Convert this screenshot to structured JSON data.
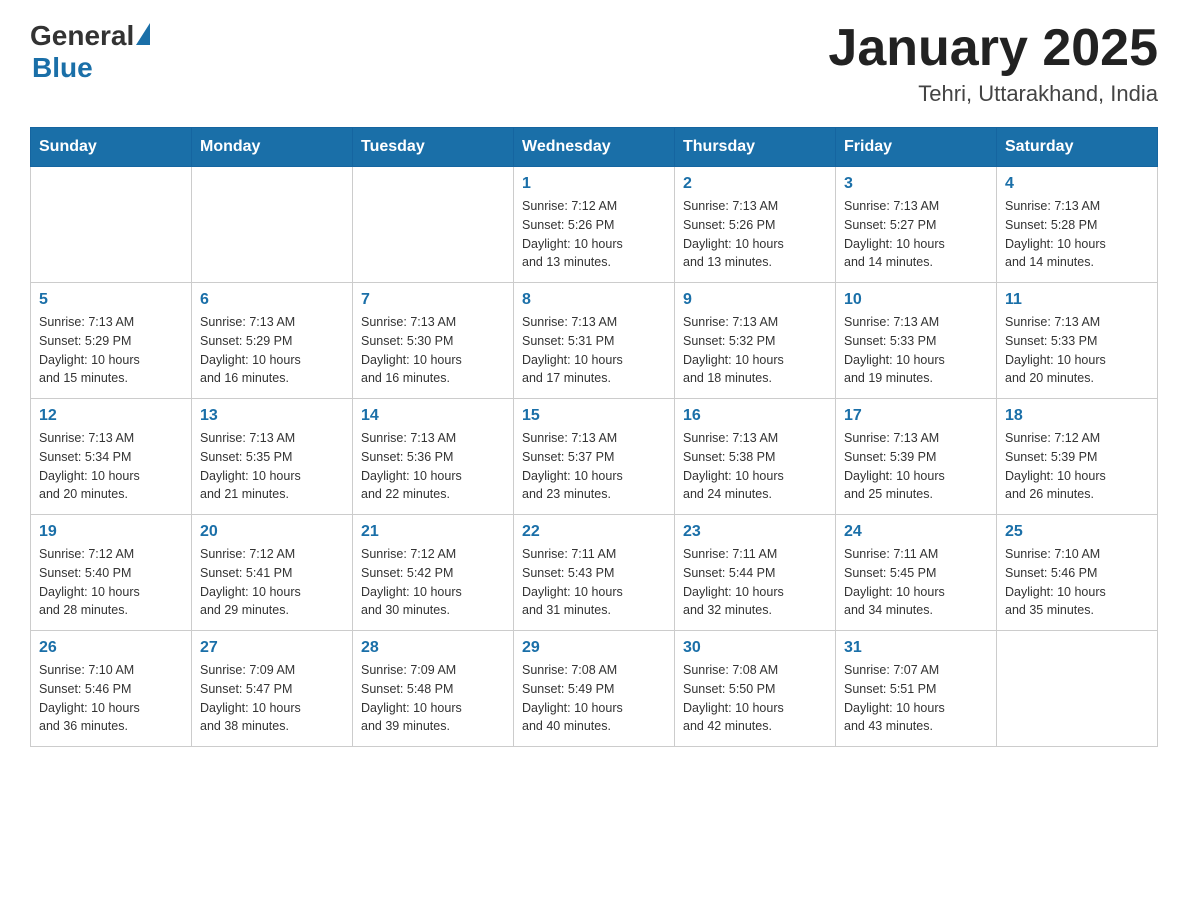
{
  "header": {
    "logo_general": "General",
    "logo_blue": "Blue",
    "month_title": "January 2025",
    "location": "Tehri, Uttarakhand, India"
  },
  "weekdays": [
    "Sunday",
    "Monday",
    "Tuesday",
    "Wednesday",
    "Thursday",
    "Friday",
    "Saturday"
  ],
  "weeks": [
    [
      {
        "day": "",
        "info": ""
      },
      {
        "day": "",
        "info": ""
      },
      {
        "day": "",
        "info": ""
      },
      {
        "day": "1",
        "info": "Sunrise: 7:12 AM\nSunset: 5:26 PM\nDaylight: 10 hours\nand 13 minutes."
      },
      {
        "day": "2",
        "info": "Sunrise: 7:13 AM\nSunset: 5:26 PM\nDaylight: 10 hours\nand 13 minutes."
      },
      {
        "day": "3",
        "info": "Sunrise: 7:13 AM\nSunset: 5:27 PM\nDaylight: 10 hours\nand 14 minutes."
      },
      {
        "day": "4",
        "info": "Sunrise: 7:13 AM\nSunset: 5:28 PM\nDaylight: 10 hours\nand 14 minutes."
      }
    ],
    [
      {
        "day": "5",
        "info": "Sunrise: 7:13 AM\nSunset: 5:29 PM\nDaylight: 10 hours\nand 15 minutes."
      },
      {
        "day": "6",
        "info": "Sunrise: 7:13 AM\nSunset: 5:29 PM\nDaylight: 10 hours\nand 16 minutes."
      },
      {
        "day": "7",
        "info": "Sunrise: 7:13 AM\nSunset: 5:30 PM\nDaylight: 10 hours\nand 16 minutes."
      },
      {
        "day": "8",
        "info": "Sunrise: 7:13 AM\nSunset: 5:31 PM\nDaylight: 10 hours\nand 17 minutes."
      },
      {
        "day": "9",
        "info": "Sunrise: 7:13 AM\nSunset: 5:32 PM\nDaylight: 10 hours\nand 18 minutes."
      },
      {
        "day": "10",
        "info": "Sunrise: 7:13 AM\nSunset: 5:33 PM\nDaylight: 10 hours\nand 19 minutes."
      },
      {
        "day": "11",
        "info": "Sunrise: 7:13 AM\nSunset: 5:33 PM\nDaylight: 10 hours\nand 20 minutes."
      }
    ],
    [
      {
        "day": "12",
        "info": "Sunrise: 7:13 AM\nSunset: 5:34 PM\nDaylight: 10 hours\nand 20 minutes."
      },
      {
        "day": "13",
        "info": "Sunrise: 7:13 AM\nSunset: 5:35 PM\nDaylight: 10 hours\nand 21 minutes."
      },
      {
        "day": "14",
        "info": "Sunrise: 7:13 AM\nSunset: 5:36 PM\nDaylight: 10 hours\nand 22 minutes."
      },
      {
        "day": "15",
        "info": "Sunrise: 7:13 AM\nSunset: 5:37 PM\nDaylight: 10 hours\nand 23 minutes."
      },
      {
        "day": "16",
        "info": "Sunrise: 7:13 AM\nSunset: 5:38 PM\nDaylight: 10 hours\nand 24 minutes."
      },
      {
        "day": "17",
        "info": "Sunrise: 7:13 AM\nSunset: 5:39 PM\nDaylight: 10 hours\nand 25 minutes."
      },
      {
        "day": "18",
        "info": "Sunrise: 7:12 AM\nSunset: 5:39 PM\nDaylight: 10 hours\nand 26 minutes."
      }
    ],
    [
      {
        "day": "19",
        "info": "Sunrise: 7:12 AM\nSunset: 5:40 PM\nDaylight: 10 hours\nand 28 minutes."
      },
      {
        "day": "20",
        "info": "Sunrise: 7:12 AM\nSunset: 5:41 PM\nDaylight: 10 hours\nand 29 minutes."
      },
      {
        "day": "21",
        "info": "Sunrise: 7:12 AM\nSunset: 5:42 PM\nDaylight: 10 hours\nand 30 minutes."
      },
      {
        "day": "22",
        "info": "Sunrise: 7:11 AM\nSunset: 5:43 PM\nDaylight: 10 hours\nand 31 minutes."
      },
      {
        "day": "23",
        "info": "Sunrise: 7:11 AM\nSunset: 5:44 PM\nDaylight: 10 hours\nand 32 minutes."
      },
      {
        "day": "24",
        "info": "Sunrise: 7:11 AM\nSunset: 5:45 PM\nDaylight: 10 hours\nand 34 minutes."
      },
      {
        "day": "25",
        "info": "Sunrise: 7:10 AM\nSunset: 5:46 PM\nDaylight: 10 hours\nand 35 minutes."
      }
    ],
    [
      {
        "day": "26",
        "info": "Sunrise: 7:10 AM\nSunset: 5:46 PM\nDaylight: 10 hours\nand 36 minutes."
      },
      {
        "day": "27",
        "info": "Sunrise: 7:09 AM\nSunset: 5:47 PM\nDaylight: 10 hours\nand 38 minutes."
      },
      {
        "day": "28",
        "info": "Sunrise: 7:09 AM\nSunset: 5:48 PM\nDaylight: 10 hours\nand 39 minutes."
      },
      {
        "day": "29",
        "info": "Sunrise: 7:08 AM\nSunset: 5:49 PM\nDaylight: 10 hours\nand 40 minutes."
      },
      {
        "day": "30",
        "info": "Sunrise: 7:08 AM\nSunset: 5:50 PM\nDaylight: 10 hours\nand 42 minutes."
      },
      {
        "day": "31",
        "info": "Sunrise: 7:07 AM\nSunset: 5:51 PM\nDaylight: 10 hours\nand 43 minutes."
      },
      {
        "day": "",
        "info": ""
      }
    ]
  ]
}
